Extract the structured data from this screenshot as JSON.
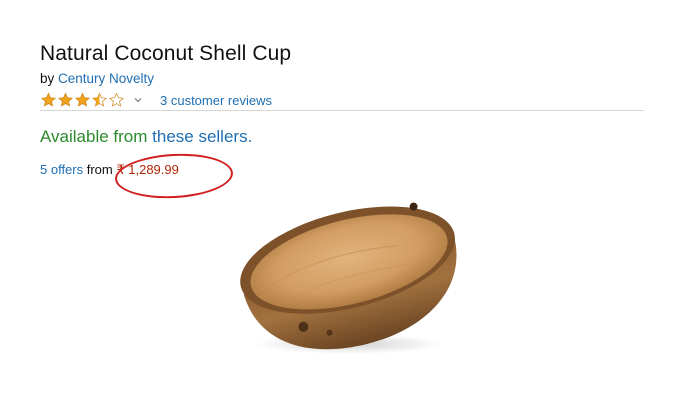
{
  "product": {
    "title": "Natural Coconut Shell Cup",
    "by_prefix": "by ",
    "brand": "Century Novelty",
    "rating": 3.5,
    "rating_max": 5,
    "reviews_text": "3 customer reviews",
    "availability_prefix": "Available from ",
    "availability_link": "these sellers.",
    "offers_link": "5 offers",
    "offers_from": " from ",
    "price": "₹ 1,289.99"
  },
  "icons": {
    "star": "star-icon",
    "chevron": "chevron-down-icon"
  },
  "colors": {
    "link": "#1f6fb2",
    "available": "#2b8a2b",
    "price": "#b12704",
    "star": "#f0a41e",
    "annotation": "#d21f1f"
  }
}
